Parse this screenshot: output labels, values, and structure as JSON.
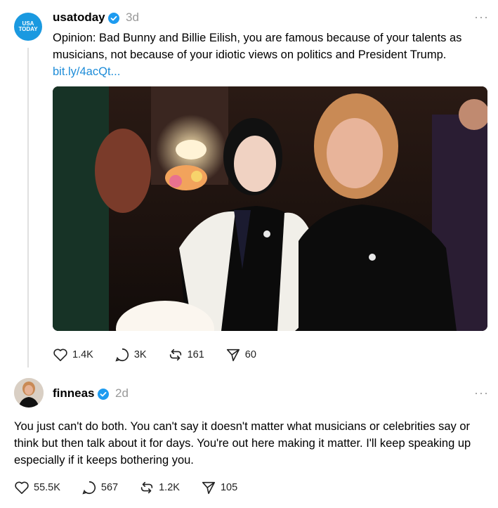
{
  "post1": {
    "avatar_text_line1": "USA",
    "avatar_text_line2": "TODAY",
    "username": "usatoday",
    "time": "3d",
    "more": "···",
    "text": "Opinion: Bad Bunny and Billie Eilish, you are famous because of your talents as musicians, not because of your idiotic views on politics and President Trump.",
    "link": "bit.ly/4acQt...",
    "actions": {
      "likes": "1.4K",
      "replies": "3K",
      "reposts": "161",
      "shares": "60"
    }
  },
  "post2": {
    "username": "finneas",
    "time": "2d",
    "more": "···",
    "text": "You just can't do both. You can't say it doesn't matter what musicians or celebrities say or think but then talk about it for days. You're out here making it matter. I'll keep speaking up especially if it keeps bothering you.",
    "actions": {
      "likes": "55.5K",
      "replies": "567",
      "reposts": "1.2K",
      "shares": "105"
    }
  },
  "colors": {
    "verified": "#1d9bf0",
    "link": "#1d8cd8",
    "usatoday_brand": "#1a99e0"
  },
  "icons": [
    "heart-icon",
    "comment-icon",
    "repost-icon",
    "share-icon",
    "verified-icon",
    "more-icon"
  ]
}
